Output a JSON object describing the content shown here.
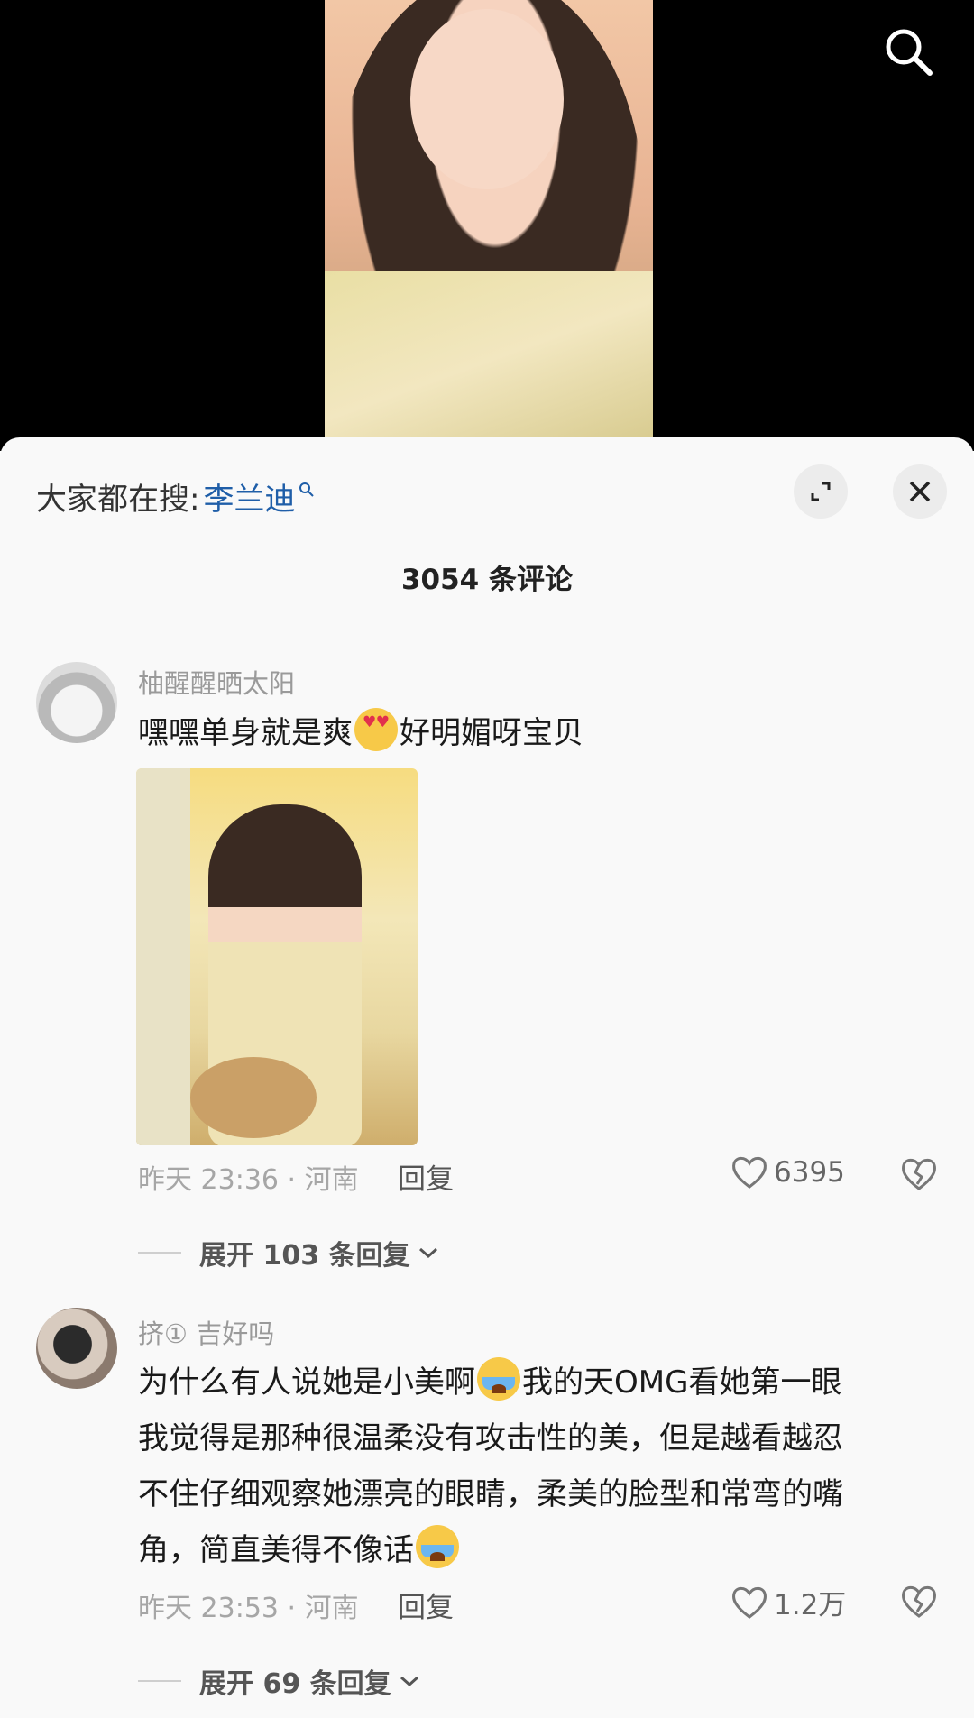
{
  "header": {
    "search_icon": "search-icon"
  },
  "sheet": {
    "hot_search_prefix": "大家都在搜:",
    "hot_search_keyword": "李兰迪",
    "expand_icon": "expand-icon",
    "close_icon": "close-icon",
    "comment_count": "3054 条评论"
  },
  "comments": [
    {
      "username": "柚醒醒晒太阳",
      "text_a": "嘿嘿单身就是爽",
      "emoji": "heart-eyes-emoji",
      "text_b": "好明媚呀宝贝",
      "meta": "昨天 23:36 · 河南",
      "reply_label": "回复",
      "likes": "6395",
      "expand_replies": "展开 103 条回复"
    },
    {
      "username": "挤① 吉好吗",
      "line1_a": "为什么有人说她是小美啊",
      "line1_b": "我的天OMG看她第一眼",
      "line2": "我觉得是那种很温柔没有攻击性的美，但是越看越忍",
      "line3": "不住仔细观察她漂亮的眼睛，柔美的脸型和常弯的嘴",
      "line4": "角，简直美得不像话",
      "emoji": "crying-emoji",
      "meta": "昨天 23:53 · 河南",
      "reply_label": "回复",
      "likes": "1.2万",
      "expand_replies": "展开 69 条回复"
    }
  ],
  "colors": {
    "keyword": "#1f5ea8",
    "sheet_background": "#f9f9f9",
    "video_background": "#000000"
  }
}
